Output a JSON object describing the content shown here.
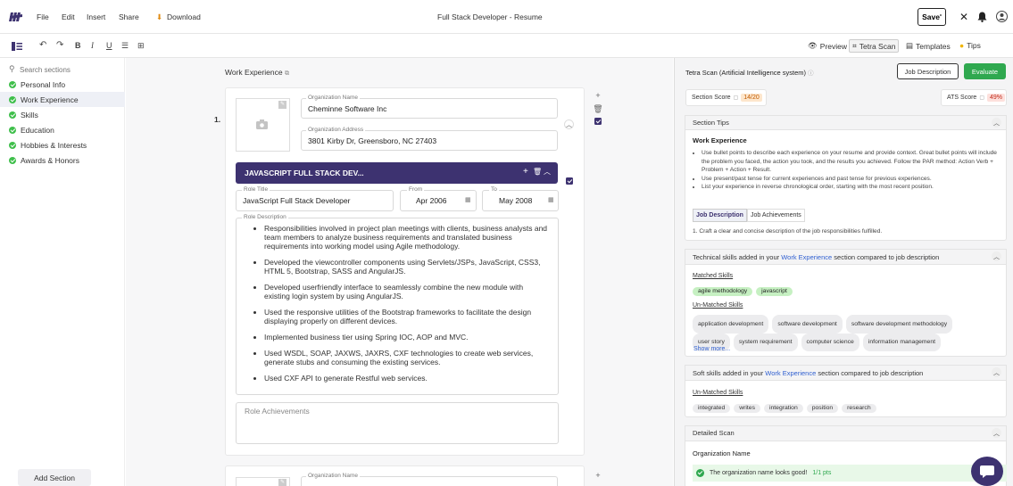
{
  "menu": {
    "file": "File",
    "edit": "Edit",
    "insert": "Insert",
    "share": "Share",
    "download": "Download"
  },
  "doc": {
    "title_bold": "Full Stack Developer",
    "title_rest": " - Resume",
    "save": "Save"
  },
  "view_tabs": {
    "preview": "Preview",
    "scan": "Tetra Scan",
    "templates": "Templates",
    "tips": "Tips"
  },
  "sidebar": {
    "search_placeholder": "Search sections",
    "items": [
      {
        "label": "Personal Info",
        "active": false
      },
      {
        "label": "Work Experience",
        "active": true
      },
      {
        "label": "Skills",
        "active": false
      },
      {
        "label": "Education",
        "active": false
      },
      {
        "label": "Hobbies & Interests",
        "active": false
      },
      {
        "label": "Awards & Honors",
        "active": false
      }
    ],
    "add_section": "Add Section"
  },
  "editor": {
    "section_title": "Work Experience",
    "entry_number": "1.",
    "org_name_label": "Organization Name",
    "org_name": "Cheminne Software Inc",
    "org_address_label": "Organization Address",
    "org_address": "3801 Kirby Dr, Greensboro, NC 27403",
    "role_bar": "JAVASCRIPT FULL STACK DEV...",
    "role_title_label": "Role Title",
    "role_title": "JavaScript Full Stack Developer",
    "from_label": "From",
    "from_value": "Apr 2006",
    "to_label": "To",
    "to_value": "May 2008",
    "role_desc_label": "Role Description",
    "bullets": [
      "Responsibilities involved in project plan meetings with clients, business analysts and team members to analyze business requirements and translated business requirements into working model using Agile methodology.",
      "Developed the viewcontroller components using Servlets/JSPs, JavaScript, CSS3, HTML 5, Bootstrap, SASS and AngularJS.",
      "Developed userfriendly interface to seamlessly combine the new module with existing login system by using AngularJS.",
      "Used the responsive utilities of the Bootstrap frameworks to facilitate the design displaying properly on different devices.",
      "Implemented business tier using Spring IOC, AOP and MVC.",
      "Used WSDL, SOAP, JAXWS, JAXRS, CXF technologies to create web services, generate stubs and consuming the existing services.",
      "Used CXF API to generate Restful web services."
    ],
    "role_achievements_label": "Role Achievements",
    "org_name_label_2": "Organization Name"
  },
  "scan": {
    "title": "Tetra Scan (Artificial Intelligence system)",
    "job_description_btn": "Job Description",
    "evaluate_btn": "Evaluate",
    "section_score_label": "Section Score",
    "section_score": "14/20",
    "ats_score_label": "ATS Score",
    "ats_score": "49%",
    "tips_title": "Section Tips",
    "tips_subtitle": "Work Experience",
    "tips": [
      "Use bullet points to describe each experience on your resume and provide context. Great bullet points will include the problem you faced, the action you took, and the results you achieved. Follow the PAR method: Action Verb + Problem + Action + Result.",
      "Use present/past tense for current experiences and past tense for previous experiences.",
      "List your experience in reverse chronological order, starting with the most recent position."
    ],
    "tab_job_desc": "Job Description",
    "tab_job_ach": "Job Achievements",
    "tip_point": "1. Craft a clear and concise description of the job responsibilities fulfilled.",
    "tech_title_pre": "Technical skills added in your ",
    "tech_title_link": "Work Experience",
    "tech_title_post": " section compared to job description",
    "matched_label": "Matched Skills",
    "matched": [
      "agile methodology",
      "javascript"
    ],
    "unmatched_label": "Un-Matched Skills",
    "unmatched": [
      "application development",
      "software development",
      "software development methodology",
      "user story",
      "system requirement",
      "computer science",
      "information management"
    ],
    "show_more": "Show more...",
    "soft_title_pre": "Soft skills added in your ",
    "soft_title_link": "Work Experience",
    "soft_title_post": " section compared to job description",
    "soft_unmatched_label": "Un-Matched Skills",
    "soft_unmatched": [
      "integrated",
      "writes",
      "integration",
      "position",
      "research"
    ],
    "detailed_title": "Detailed Scan",
    "detailed_sub": "Organization Name",
    "detailed_ok": "The organization name looks good!",
    "detailed_pts": "1/1 pts"
  },
  "colors": {
    "brand": "#3d3270",
    "green": "#2fa84f",
    "accent_link": "#2f5fd0"
  }
}
